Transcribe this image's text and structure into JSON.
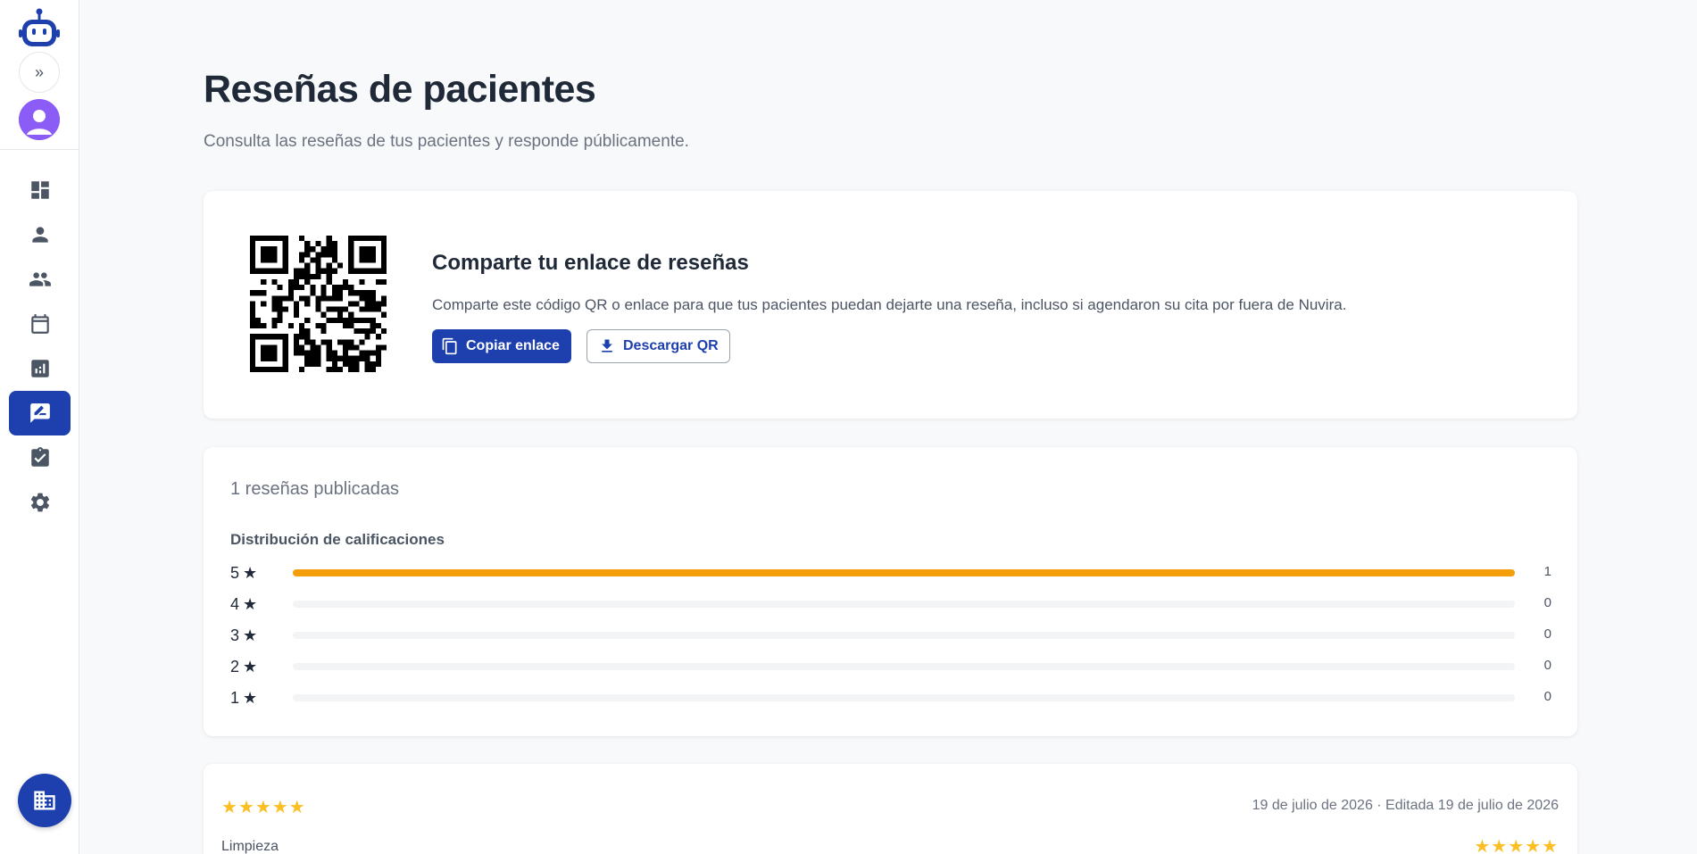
{
  "page": {
    "title": "Reseñas de pacientes",
    "subtitle": "Consulta las reseñas de tus pacientes y responde públicamente."
  },
  "sidebar": {
    "items": [
      {
        "icon": "dashboard-icon",
        "active": false
      },
      {
        "icon": "person-icon",
        "active": false
      },
      {
        "icon": "people-icon",
        "active": false
      },
      {
        "icon": "calendar-icon",
        "active": false
      },
      {
        "icon": "analytics-icon",
        "active": false
      },
      {
        "icon": "reviews-icon",
        "active": true
      },
      {
        "icon": "tasks-icon",
        "active": false
      },
      {
        "icon": "settings-icon",
        "active": false
      }
    ],
    "accent_color": "#1e40af"
  },
  "share": {
    "title": "Comparte tu enlace de reseñas",
    "description": "Comparte este código QR o enlace para que tus pacientes puedan dejarte una reseña, incluso si agendaron su cita por fuera de Nuvira.",
    "copy_label": "Copiar enlace",
    "download_label": "Descargar QR"
  },
  "summary": {
    "count_text": "1 reseñas publicadas",
    "distribution_title": "Distribución de calificaciones",
    "rows": [
      {
        "label": "5",
        "count": "1",
        "fraction": 1
      },
      {
        "label": "4",
        "count": "0",
        "fraction": 0
      },
      {
        "label": "3",
        "count": "0",
        "fraction": 0
      },
      {
        "label": "2",
        "count": "0",
        "fraction": 0
      },
      {
        "label": "1",
        "count": "0",
        "fraction": 0
      }
    ],
    "bar_color": "#f59e0b"
  },
  "review": {
    "rating": 5,
    "date_text": "19 de julio de 2026 · Editada 19 de julio de 2026",
    "category": "Limpieza",
    "category_rating": 5
  }
}
